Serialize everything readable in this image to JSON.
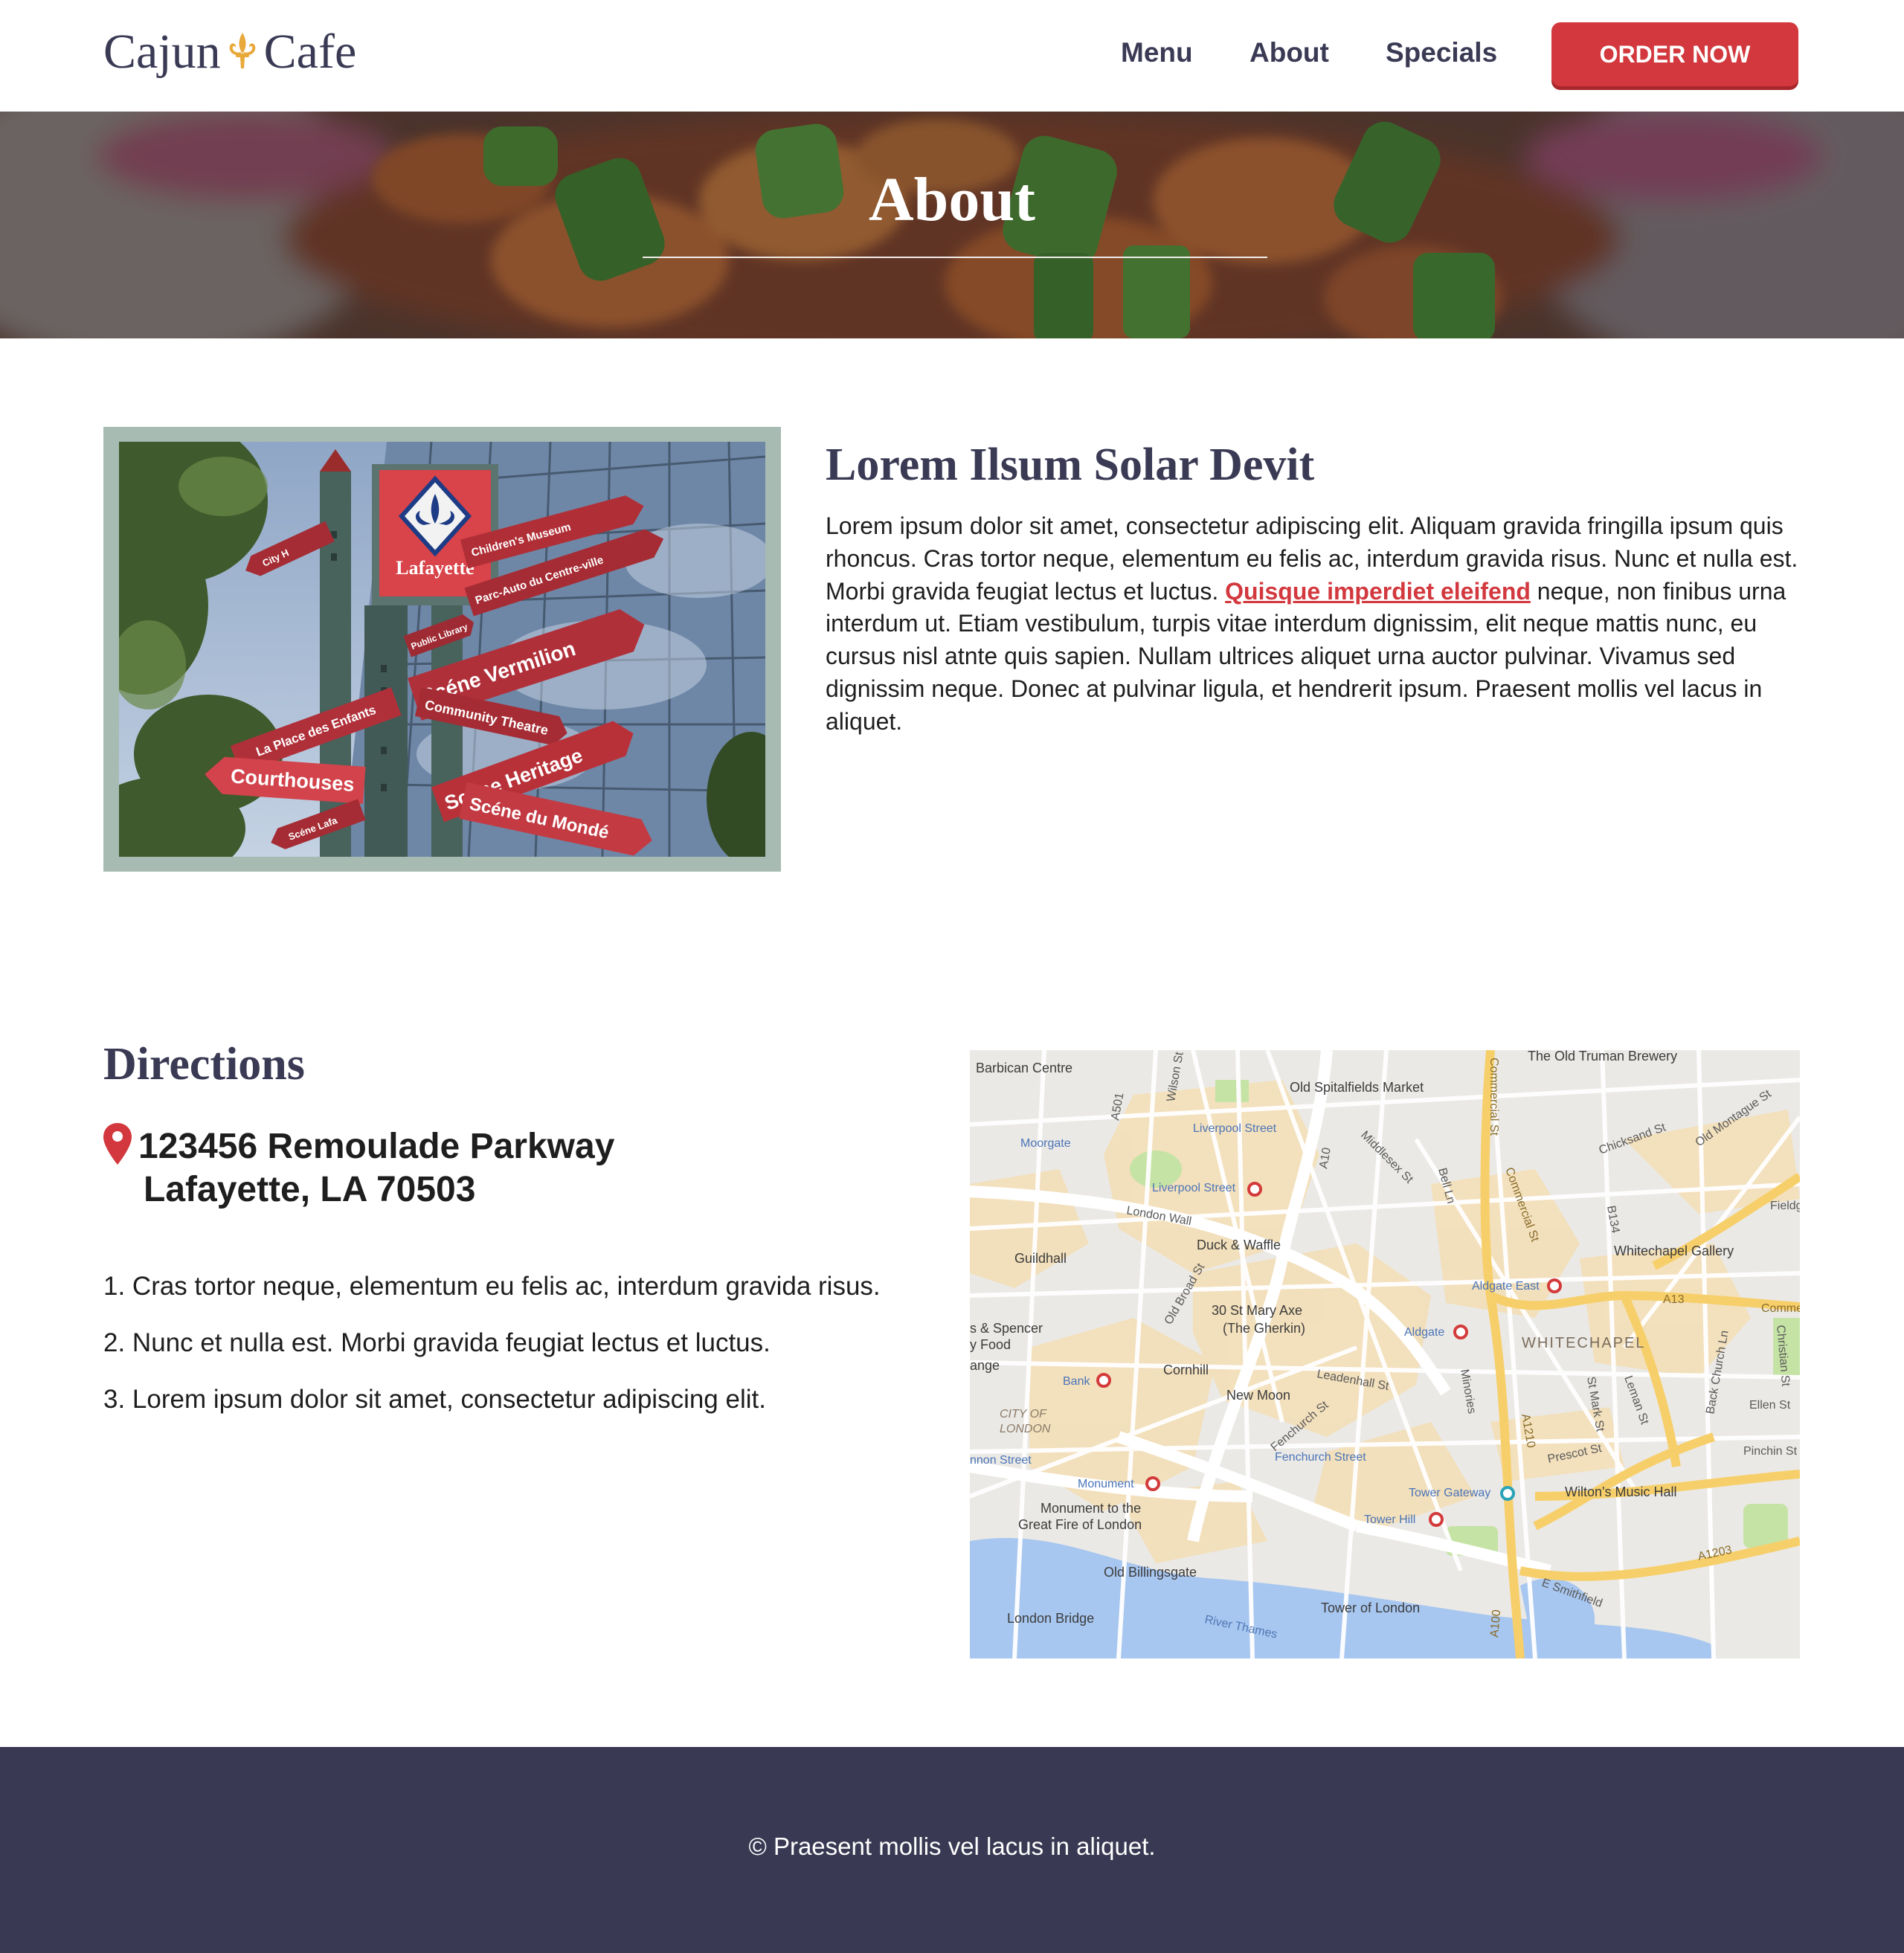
{
  "header": {
    "logo_left": "Cajun",
    "logo_right": "Cafe",
    "nav": [
      {
        "label": "Menu"
      },
      {
        "label": "About"
      },
      {
        "label": "Specials"
      }
    ],
    "order_label": "ORDER NOW"
  },
  "hero": {
    "title": "About"
  },
  "about": {
    "heading": "Lorem Ilsum Solar Devit",
    "text_before": "Lorem ipsum dolor sit amet, consectetur adipiscing elit. Aliquam gravida fringilla ipsum quis rhoncus. Cras tortor neque, elementum eu felis ac, interdum gravida risus. Nunc et nulla est. Morbi gravida feugiat lectus et luctus. ",
    "link_text": "Quisque imperdiet eleifend",
    "text_after": " neque, non finibus urna interdum ut. Etiam vestibulum, turpis vitae interdum dignissim, elit neque mattis nunc, eu cursus nisl atnte quis sapien. Nullam ultrices aliquet urna auctor pulvinar. Vivamus sed dignissim neque. Donec at pulvinar ligula, et hendrerit ipsum. Praesent mollis vel lacus in aliquet.",
    "photo_signs": {
      "main": "Lafayette",
      "s1": "Children's Museum",
      "s2": "Parc-Auto du Centre-ville",
      "s3": "Public Library",
      "s4": "Scéne Vermilion",
      "s5": "Community Theatre",
      "s6": "La Place des Enfants",
      "s7": "Courthouses",
      "s8": "Scéne Heritage",
      "s9": "Scéne du Mondé",
      "s10": "Scéne Lafa",
      "s11": "City H"
    }
  },
  "directions": {
    "heading": "Directions",
    "address_line1": "123456 Remoulade Parkway",
    "address_line2": "Lafayette, LA 70503",
    "steps": [
      "1. Cras tortor neque, elementum eu felis ac, interdum gravida risus.",
      "2. Nunc et nulla est. Morbi gravida feugiat lectus et luctus.",
      "3.  Lorem ipsum dolor sit amet, consectetur adipiscing elit."
    ]
  },
  "map": {
    "labels": {
      "barbican": "Barbican Centre",
      "truman": "The Old Truman Brewery",
      "spitalfields": "Old Spitalfields Market",
      "liverpool1": "Liverpool Street",
      "liverpool2": "Liverpool Street",
      "moorgate": "Moorgate",
      "chicksand": "Chicksand St",
      "oldmontague": "Old Montague St",
      "fieldgate": "Fieldgate",
      "londonwall": "London Wall",
      "duck": "Duck & Waffle",
      "whitechapel_gallery": "Whitechapel Gallery",
      "guildhall": "Guildhall",
      "aldgate_east": "Aldgate East",
      "a13": "A13",
      "commercial": "Commerc",
      "gherkin1": "30 St Mary Axe",
      "gherkin2": "(The Gherkin)",
      "aldgate": "Aldgate",
      "whitechapel": "WHITECHAPEL",
      "spencer": "s & Spencer",
      "food": "y Food",
      "ange": "ange",
      "cornhill": "Cornhill",
      "leadenhall": "Leadenhall St",
      "bank": "Bank",
      "cityof": "CITY OF",
      "london": "LONDON",
      "newmoon": "New Moon",
      "ellen": "Ellen St",
      "pinchin": "Pinchin St",
      "prescot": "Prescot St",
      "cannon": "nnon Street",
      "fenchurch": "Fenchurch Street",
      "monument": "Monument",
      "wiltons": "Wilton's Music Hall",
      "towergateway": "Tower Gateway",
      "monfire1": "Monument to the",
      "monfire2": "Great Fire of London",
      "towerhill": "Tower Hill",
      "a1203": "A1203",
      "billingsgate": "Old Billingsgate",
      "esmithfield": "E Smithfield",
      "londonbridge": "London Bridge",
      "toweroflondon": "Tower of London",
      "thames": "River Thames",
      "a100": "A100",
      "a1210": "A1210",
      "a10": "A10",
      "a501": "A501",
      "b134": "B134",
      "wilson": "Wilson St",
      "middlesex": "Middlesex St",
      "bell": "Bell Ln",
      "commercialst": "Commercial St",
      "commercialst2": "Commercial St",
      "oldbroad": "Old Broad St",
      "minories": "Minories",
      "stmark": "St Mark St",
      "leman": "Leman St",
      "backchurch": "Back Church Ln",
      "christian": "Christian St",
      "fenchurchst": "Fenchurch St"
    }
  },
  "footer": {
    "text": "© Praesent mollis vel lacus in aliquet."
  },
  "colors": {
    "brand_navy": "#3a3a55",
    "accent_red": "#d2383d",
    "footer_bg": "#393953",
    "photo_frame": "#a7bbb2",
    "fleur_gold": "#e8a93a"
  }
}
